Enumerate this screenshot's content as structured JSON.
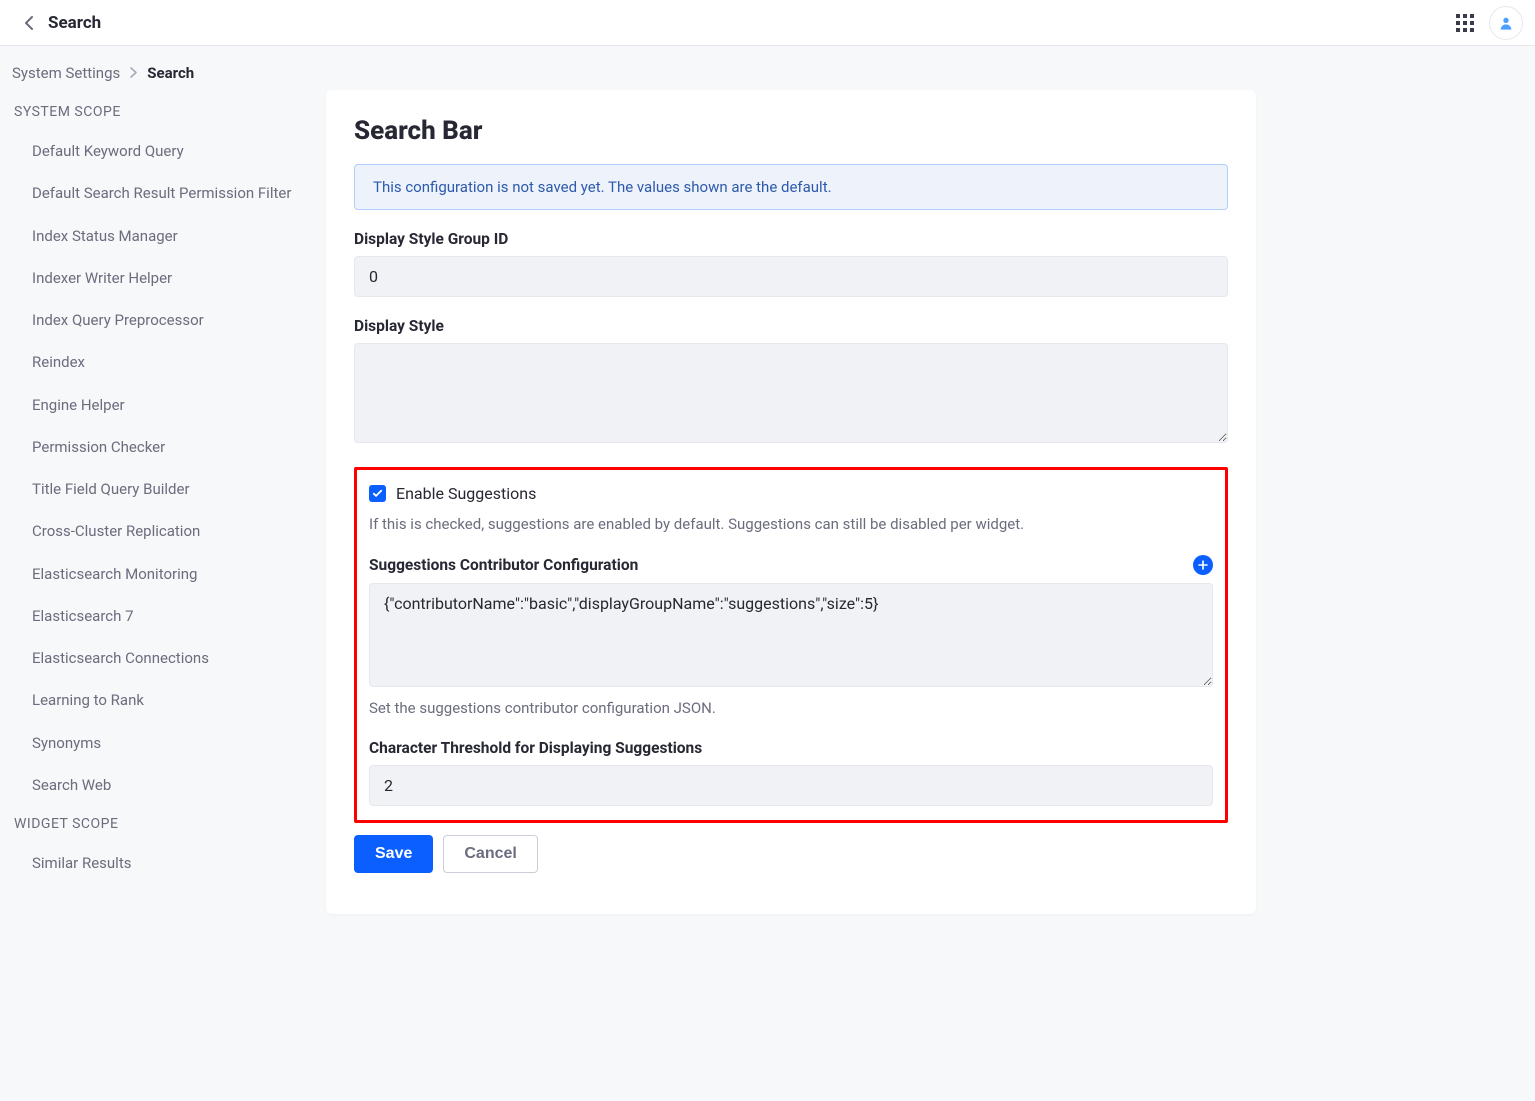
{
  "topbar": {
    "title": "Search"
  },
  "breadcrumb": {
    "root": "System Settings",
    "current": "Search"
  },
  "sidebar": {
    "group1_header": "SYSTEM SCOPE",
    "items1": [
      "Default Keyword Query",
      "Default Search Result Permission Filter",
      "Index Status Manager",
      "Indexer Writer Helper",
      "Index Query Preprocessor",
      "Reindex",
      "Engine Helper",
      "Permission Checker",
      "Title Field Query Builder",
      "Cross-Cluster Replication",
      "Elasticsearch Monitoring",
      "Elasticsearch 7",
      "Elasticsearch Connections",
      "Learning to Rank",
      "Synonyms",
      "Search Web"
    ],
    "group2_header": "WIDGET SCOPE",
    "items2": [
      "Similar Results"
    ]
  },
  "page": {
    "heading": "Search Bar",
    "alert": "This configuration is not saved yet. The values shown are the default.",
    "fields": {
      "display_style_group_id": {
        "label": "Display Style Group ID",
        "value": "0"
      },
      "display_style": {
        "label": "Display Style",
        "value": ""
      },
      "enable_suggestions": {
        "label": "Enable Suggestions",
        "help": "If this is checked, suggestions are enabled by default. Suggestions can still be disabled per widget."
      },
      "suggestions_contributor": {
        "label": "Suggestions Contributor Configuration",
        "value": "{\"contributorName\":\"basic\",\"displayGroupName\":\"suggestions\",\"size\":5}",
        "help": "Set the suggestions contributor configuration JSON."
      },
      "char_threshold": {
        "label": "Character Threshold for Displaying Suggestions",
        "value": "2"
      }
    },
    "buttons": {
      "save": "Save",
      "cancel": "Cancel"
    }
  }
}
